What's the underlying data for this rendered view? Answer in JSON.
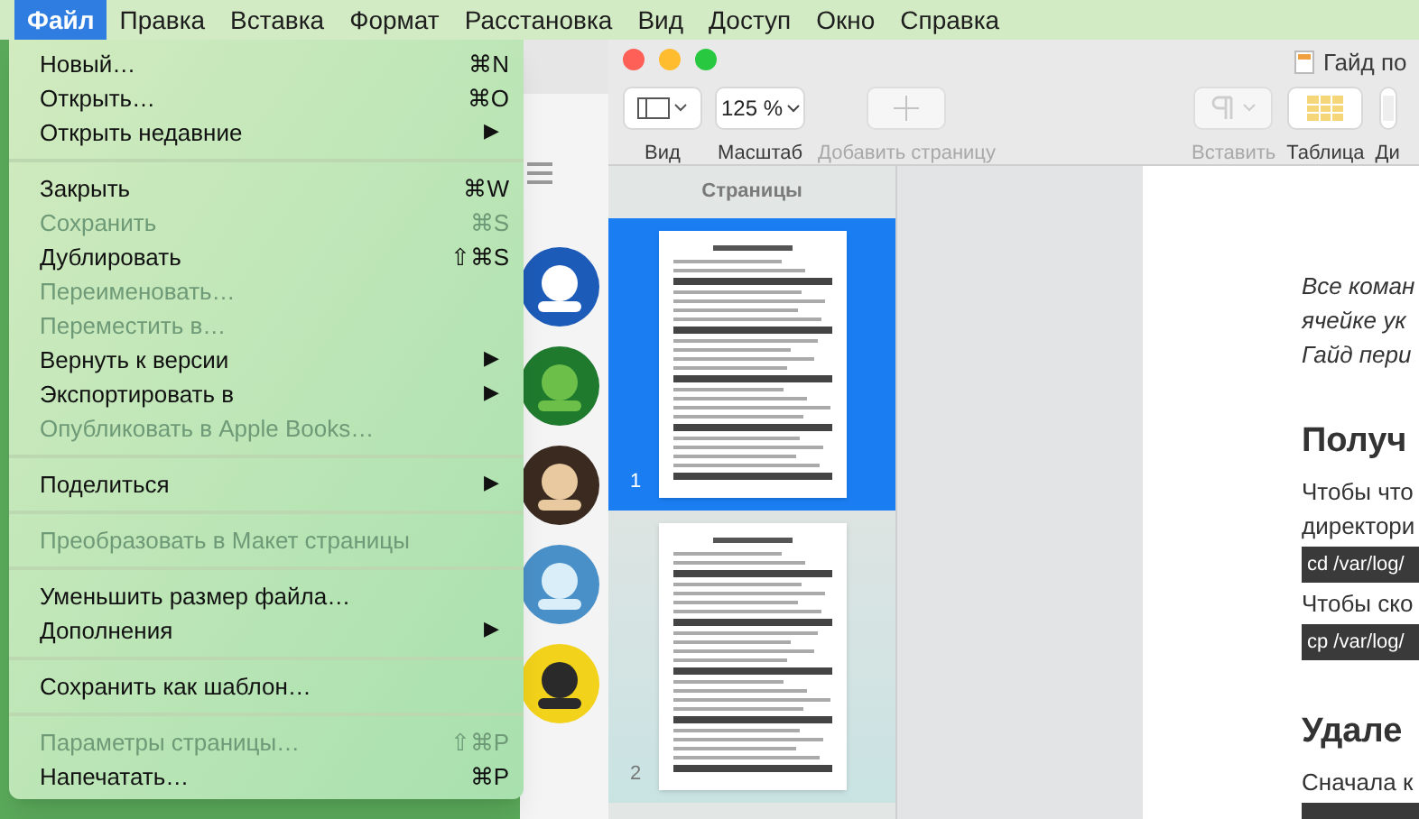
{
  "menubar": [
    {
      "label": "Файл",
      "selected": true
    },
    {
      "label": "Правка",
      "selected": false
    },
    {
      "label": "Вставка",
      "selected": false
    },
    {
      "label": "Формат",
      "selected": false
    },
    {
      "label": "Расстановка",
      "selected": false
    },
    {
      "label": "Вид",
      "selected": false
    },
    {
      "label": "Доступ",
      "selected": false
    },
    {
      "label": "Окно",
      "selected": false
    },
    {
      "label": "Справка",
      "selected": false
    }
  ],
  "file_menu": {
    "sections": [
      [
        {
          "label": "Новый…",
          "shortcut": "⌘N",
          "disabled": false
        },
        {
          "label": "Открыть…",
          "shortcut": "⌘O",
          "disabled": false
        },
        {
          "label": "Открыть недавние",
          "arrow": "▶",
          "disabled": false
        }
      ],
      [
        {
          "label": "Закрыть",
          "shortcut": "⌘W",
          "disabled": false
        },
        {
          "label": "Сохранить",
          "shortcut": "⌘S",
          "disabled": true
        },
        {
          "label": "Дублировать",
          "shortcut": "⇧⌘S",
          "disabled": false
        },
        {
          "label": "Переименовать…",
          "disabled": true
        },
        {
          "label": "Переместить в…",
          "disabled": true
        },
        {
          "label": "Вернуть к версии",
          "arrow": "▶",
          "disabled": false
        },
        {
          "label": "Экспортировать в",
          "arrow": "▶",
          "disabled": false
        },
        {
          "label": "Опубликовать в Apple Books…",
          "disabled": true
        }
      ],
      [
        {
          "label": "Поделиться",
          "arrow": "▶",
          "disabled": false
        }
      ],
      [
        {
          "label": "Преобразовать в Макет страницы",
          "disabled": true
        }
      ],
      [
        {
          "label": "Уменьшить размер файла…",
          "disabled": false
        },
        {
          "label": "Дополнения",
          "arrow": "▶",
          "disabled": false
        }
      ],
      [
        {
          "label": "Сохранить как шаблон…",
          "disabled": false
        }
      ],
      [
        {
          "label": "Параметры страницы…",
          "shortcut": "⇧⌘P",
          "disabled": true
        },
        {
          "label": "Напечатать…",
          "shortcut": "⌘P",
          "disabled": false
        }
      ]
    ]
  },
  "pages_window": {
    "title": "Гайд по",
    "toolbar_left": [
      {
        "kind": "view",
        "label": "Вид",
        "disabled": false
      },
      {
        "kind": "zoom",
        "value": "125 %",
        "label": "Масштаб",
        "disabled": false
      },
      {
        "kind": "add",
        "label": "Добавить страницу",
        "disabled": true
      }
    ],
    "toolbar_right": [
      {
        "kind": "insert",
        "label": "Вставить",
        "disabled": true
      },
      {
        "kind": "table",
        "label": "Таблица",
        "disabled": false
      },
      {
        "kind": "cut",
        "label": "Ди"
      }
    ],
    "sidebar": {
      "header": "Страницы",
      "pages": [
        {
          "number": "1",
          "selected": true
        },
        {
          "number": "2",
          "selected": false
        }
      ]
    },
    "document": [
      {
        "kind": "italic",
        "text": "Все коман"
      },
      {
        "kind": "italic",
        "text": "ячейке ук"
      },
      {
        "kind": "italic",
        "text": "Гайд пери"
      },
      {
        "kind": "heading",
        "text": "Получ"
      },
      {
        "kind": "para",
        "text": "Чтобы что"
      },
      {
        "kind": "para",
        "text": "директори"
      },
      {
        "kind": "code",
        "text": "cd /var/log/"
      },
      {
        "kind": "para",
        "text": "Чтобы ско"
      },
      {
        "kind": "code",
        "text": "cp /var/log/"
      },
      {
        "kind": "heading",
        "text": "Удале"
      },
      {
        "kind": "para",
        "text": "Сначала к"
      },
      {
        "kind": "code"
      }
    ]
  }
}
